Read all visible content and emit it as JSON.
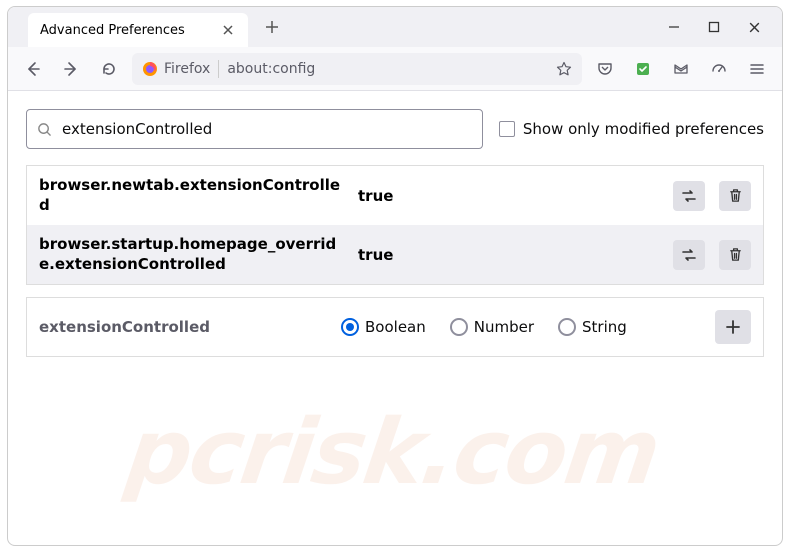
{
  "window": {
    "tab_title": "Advanced Preferences"
  },
  "toolbar": {
    "firefox_label": "Firefox",
    "url": "about:config"
  },
  "search": {
    "value": "extensionControlled",
    "checkbox_label": "Show only modified preferences"
  },
  "prefs": [
    {
      "name": "browser.newtab.extensionControlled",
      "value": "true"
    },
    {
      "name": "browser.startup.homepage_override.extensionControlled",
      "value": "true"
    }
  ],
  "new_pref": {
    "name": "extensionControlled",
    "types": [
      "Boolean",
      "Number",
      "String"
    ],
    "selected": 0
  },
  "watermark": "pcrisk.com"
}
